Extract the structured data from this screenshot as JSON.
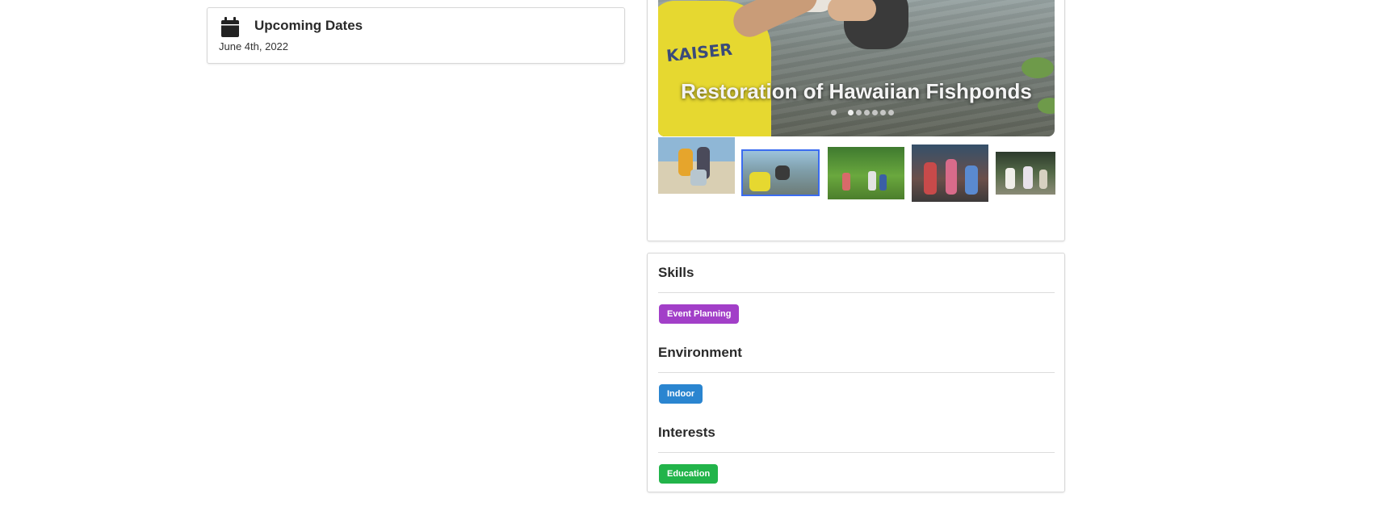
{
  "upcoming": {
    "icon": "calendar-icon",
    "title": "Upcoming Dates",
    "date": "June 4th, 2022"
  },
  "carousel": {
    "caption": "Restoration of Hawaiian Fishponds",
    "slide_count": 7,
    "active_index": 1,
    "thumbnails": [
      {
        "subject": "beach-cleanup",
        "selected": false
      },
      {
        "subject": "fishpond-restoration",
        "selected": true
      },
      {
        "subject": "field-group",
        "selected": false
      },
      {
        "subject": "crowd-group",
        "selected": false
      },
      {
        "subject": "tent-volunteers",
        "selected": false
      }
    ]
  },
  "sections": [
    {
      "title": "Skills",
      "tag": "Event Planning",
      "color": "#a23fc8"
    },
    {
      "title": "Environment",
      "tag": "Indoor",
      "color": "#2a85d0"
    },
    {
      "title": "Interests",
      "tag": "Education",
      "color": "#22b44a"
    }
  ]
}
